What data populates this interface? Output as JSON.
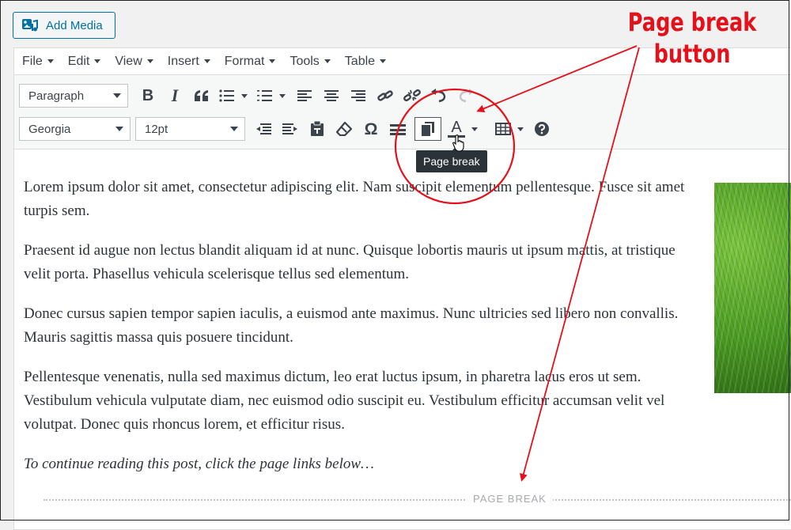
{
  "add_media": {
    "label": "Add Media"
  },
  "menubar": {
    "items": [
      {
        "label": "File"
      },
      {
        "label": "Edit"
      },
      {
        "label": "View"
      },
      {
        "label": "Insert"
      },
      {
        "label": "Format"
      },
      {
        "label": "Tools"
      },
      {
        "label": "Table"
      }
    ]
  },
  "toolbar": {
    "block_format": "Paragraph",
    "font_family": "Georgia",
    "font_size": "12pt",
    "row1_icons": [
      "bold-icon",
      "italic-icon",
      "blockquote-icon",
      "bullet-list-icon",
      "numbered-list-icon",
      "align-left-icon",
      "align-center-icon",
      "align-right-icon",
      "link-icon",
      "unlink-icon",
      "undo-icon",
      "redo-icon"
    ],
    "row2_icons": [
      "outdent-icon",
      "indent-icon",
      "paste-text-icon",
      "clear-formatting-icon",
      "special-character-icon",
      "horizontal-line-icon",
      "page-break-icon",
      "text-color-icon",
      "table-icon",
      "help-icon"
    ],
    "bold_glyph": "B",
    "italic_glyph": "I",
    "omega_glyph": "Ω",
    "text_color_glyph": "A"
  },
  "tooltip": {
    "text": "Page break"
  },
  "content": {
    "paragraphs": [
      "Lorem ipsum dolor sit amet, consectetur adipiscing elit. Nam suscipit elementum pellentesque. Fusce sit amet turpis sem.",
      "Praesent id augue non lectus blandit aliquam id at nunc. Quisque lobortis mauris ut ipsum mattis, at tristique velit porta. Phasellus vehicula scelerisque tellus sed elementum.",
      "Donec cursus sapien tempor sapien iaculis, a euismod ante maximus. Nunc ultricies sed libero non convallis. Mauris sagittis massa quis posuere tincidunt.",
      "Pellentesque venenatis, nulla sed maximus dictum, leo erat luctus ipsum, in pharetra lacus eros ut sem. Vestibulum vehicula vulputate diam, nec euismod odio suscipit eu. Vestibulum efficitur accumsan velit vel volutpat. Donec quis rhoncus lorem, et efficitur risus.",
      "To continue reading this post, click the page links below…"
    ],
    "page_break_label": "PAGE BREAK"
  },
  "annotation": {
    "line1": "Page break",
    "line2": "button",
    "color": "#e5101a"
  },
  "colors": {
    "accent": "#0071a1",
    "annotation": "#e5101a",
    "tooltip_bg": "#2c3338"
  }
}
